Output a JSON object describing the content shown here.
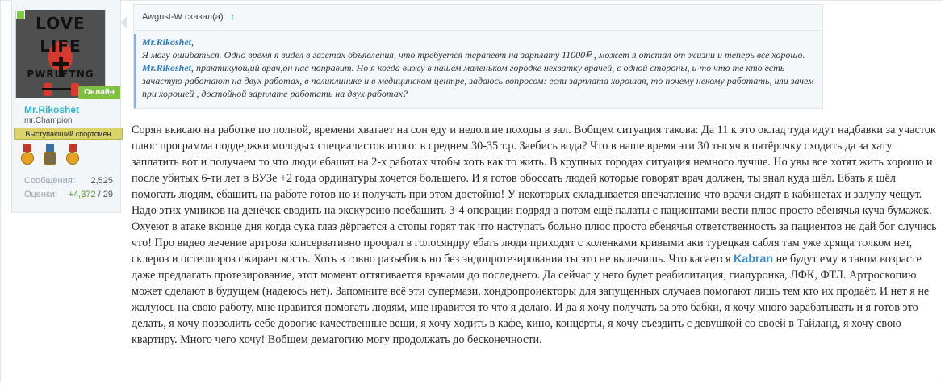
{
  "user": {
    "avatar_text": {
      "line1": "LOVE",
      "line2": "LIFE",
      "line3": "PWRLFTNG"
    },
    "online_label": "Онлайн",
    "name": "Mr.Rikoshet",
    "title": "mr.Champion",
    "rank": "Выступающий спортсмен",
    "stats": {
      "messages_label": "Сообщения:",
      "messages_value": "2,525",
      "ratings_label": "Оценки:",
      "ratings_positive": "+4,372",
      "ratings_rest": " / 29"
    }
  },
  "quote": {
    "author_line": "Awgust-W сказал(а):",
    "arrow": "↑",
    "mention1": "Mr.Rikoshet",
    "text1_after_mention": ",",
    "text2": "Я могу ошибаться. Одно время я видел в газетах объявления, что требуется терапевт на зарплату 11000₽ , может я отстал от жизни и теперь все хорошо.",
    "mention2": "Mr.Rikoshet",
    "text3": ", практикующий врач,он нас поправит. Но я когда вижу в нашем маленьком городке нехватку врачей, с одной стороны, и то что те кто есть зачастую работают на двух работах, в поликлинике и в медицинском центре, задаюсь вопросом: если зарплата хорошая, то почему некому работать, или зачем при хорошей , достойной зарплате работать на двух работах?"
  },
  "message": {
    "part1": "Сорян вкисаю на работке по полной, времени хватает на сон еду и недолгие походы в зал. Вобщем ситуация такова: Да 11 к это оклад туда идут надбавки за участок плюс программа поддержки молодых специалистов итого: в среднем 30-35 т.р. Заебись вода? Что в наше время эти 30 тысяч в пятёрочку сходить да за хату заплатить вот и получаем то что люди ебашат на 2-х работах чтобы хоть как то жить. В крупных городах ситуация немного лучше. Но увы все хотят жить хорошо и после убитых 6-ти лет в ВУЗе +2 года ординатуры хочется большего. И я готов обоссать людей которые говорят врач должен, ты знал куда шёл. Ебать я шёл помогать людям, ебашить на работе готов но и получать при этом достойно! У некоторых складывается впечатление что врачи сидят в кабинетах и залупу чещут. Надо этих умников на денёчек сводить на экскурсию поебашить 3-4 операции подряд а потом ещё палаты с пациентами вести плюс просто ебенячья куча бумажек. Охуеют в атаке вконце дня когда сука глаз дёргается а стопы горят так что наступать больно плюс просто ебенячья ответственность за пациентов не дай бог случись что! Про видео лечение артроза консервативно проорал в голосяндру ебать люди приходят с коленками кривыми аки турецкая сабля там уже хряща толком нет, склероз и остеопороз сжирает кость. Хоть в говно разъебись но без эндопротезирования ты это не вылечишь. Что касается ",
    "mention": "Kabran",
    "part2": " не будут ему в таком возрасте даже предлагать протезирование, этот момент оттягивается врачами до последнего. Да сейчас у него будет реабилитация, гиалуронка, ЛФК, ФТЛ. Артроскопию может сделают в будущем (надеюсь нет). Запомните всё эти супермази, хондропроиекторы для запущенных случаев помогают лишь тем кто их продаёт. И нет я не жалуюсь на свою работу, мне нравится помогать людям, мне нравится то что я делаю. И да я хочу получать за это бабки, я хочу много зарабатывать и я готов это делать, я хочу позволить себе дорогие качественные вещи, я хочу ходить в кафе, кино, концерты, я хочу съездить с девушкой со своей в Тайланд, я хочу свою квартиру. Много чего хочу! Вобщем демагогию могу продолжать до бесконечности."
  },
  "colors": {
    "username": "#36b2d3",
    "mention": "#3a8ed4",
    "online": "#7fbf42",
    "rank_badge": "#d9d36a"
  },
  "icons": [
    "medal-icon",
    "medal-icon",
    "medal-icon"
  ]
}
